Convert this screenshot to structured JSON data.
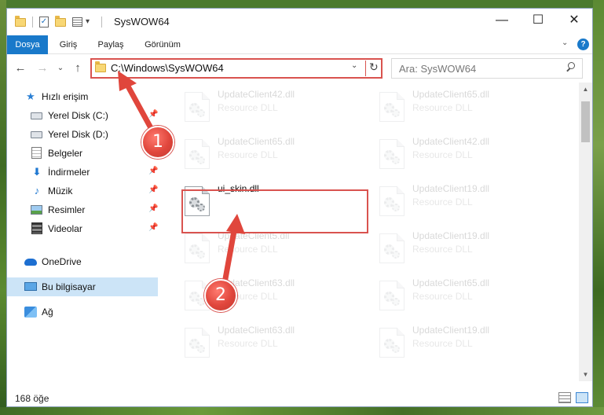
{
  "window": {
    "title": "SysWOW64",
    "minimize": "—",
    "maximize": "☐",
    "close": "✕"
  },
  "ribbon": {
    "tabs": [
      "Dosya",
      "Giriş",
      "Paylaş",
      "Görünüm"
    ],
    "active_tab": "Dosya",
    "collapse": "⌄",
    "help": "?"
  },
  "quick_access": {
    "dropdown": "▾"
  },
  "nav": {
    "back": "←",
    "forward": "→",
    "recent": "⌄",
    "up": "↑"
  },
  "address": {
    "path": "C:\\Windows\\SysWOW64",
    "dropdown": "⌄",
    "refresh": "↻"
  },
  "search": {
    "placeholder": "Ara: SysWOW64"
  },
  "sidebar": {
    "pin_glyph": "📌",
    "items": [
      {
        "label": "Hızlı erişim",
        "icon": "star-icon"
      },
      {
        "label": "Yerel Disk (C:)",
        "icon": "drive-icon"
      },
      {
        "label": "Yerel Disk (D:)",
        "icon": "drive-icon"
      },
      {
        "label": "Belgeler",
        "icon": "documents-icon"
      },
      {
        "label": "İndirmeler",
        "icon": "download-icon"
      },
      {
        "label": "Müzik",
        "icon": "music-icon"
      },
      {
        "label": "Resimler",
        "icon": "pictures-icon"
      },
      {
        "label": "Videolar",
        "icon": "videos-icon"
      },
      {
        "label": "OneDrive",
        "icon": "cloud-icon"
      },
      {
        "label": "Bu bilgisayar",
        "icon": "computer-icon"
      },
      {
        "label": "Ağ",
        "icon": "network-icon"
      }
    ]
  },
  "files": [
    {
      "name": "UpdateClient42.dll",
      "type": "Resource DLL"
    },
    {
      "name": "UpdateClient65.dll",
      "type": "Resource DLL"
    },
    {
      "name": "UpdateClient65.dll",
      "type": "Resource DLL"
    },
    {
      "name": "UpdateClient42.dll",
      "type": "Resource DLL"
    },
    {
      "name": "ui_skin.dll",
      "type": ""
    },
    {
      "name": "UpdateClient19.dll",
      "type": "Resource DLL"
    },
    {
      "name": "UpdateClient5.dll",
      "type": "Resource DLL"
    },
    {
      "name": "UpdateClient19.dll",
      "type": "Resource DLL"
    },
    {
      "name": "UpdateClient63.dll",
      "type": "Resource DLL"
    },
    {
      "name": "UpdateClient65.dll",
      "type": "Resource DLL"
    },
    {
      "name": "UpdateClient63.dll",
      "type": "Resource DLL"
    },
    {
      "name": "UpdateClient19.dll",
      "type": "Resource DLL"
    }
  ],
  "status": {
    "item_count": "168 öğe"
  },
  "scrollbar": {
    "up": "▲",
    "down": "▼"
  },
  "annotations": {
    "step1": "1",
    "step2": "2",
    "color": "#d9534f"
  }
}
